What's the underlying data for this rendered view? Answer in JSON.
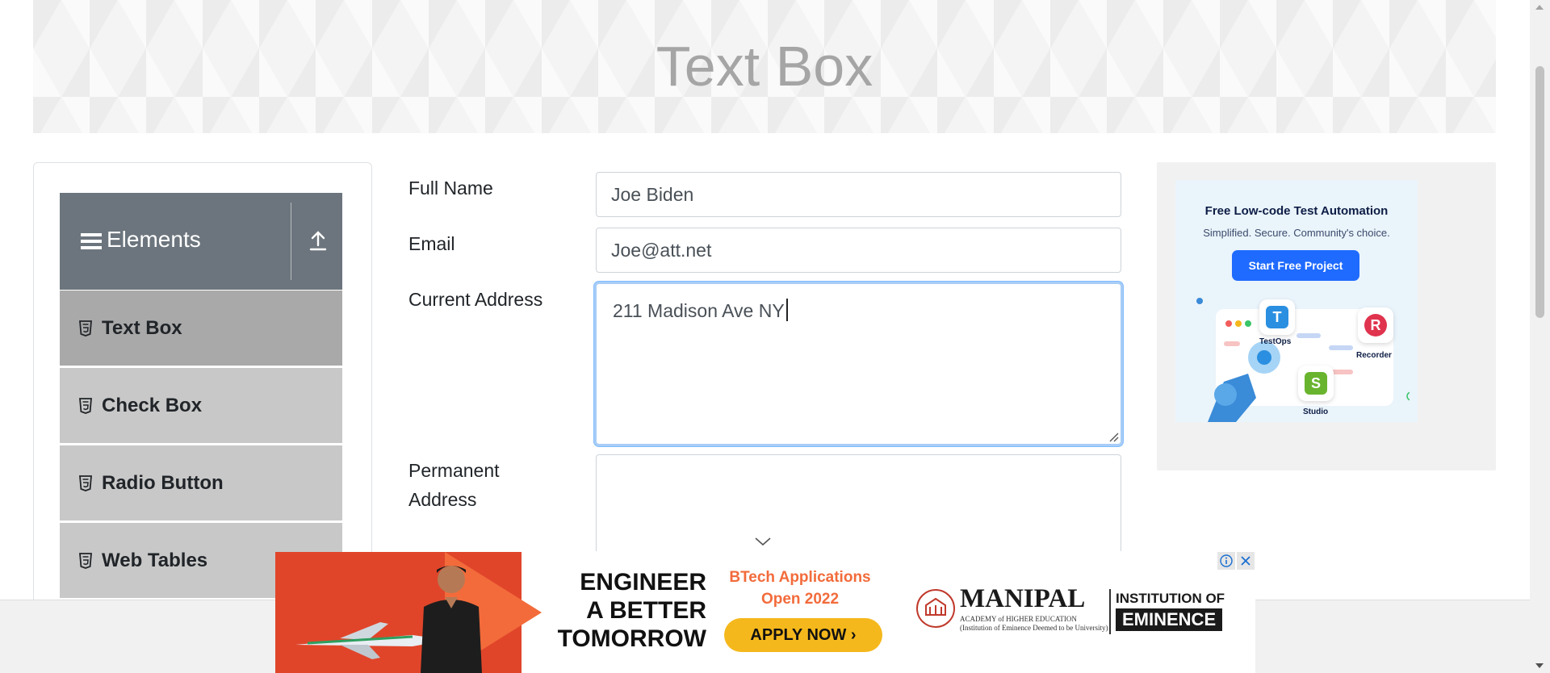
{
  "page": {
    "title": "Text Box"
  },
  "sidebar": {
    "group_title": "Elements",
    "items": [
      {
        "label": "Text Box",
        "active": true
      },
      {
        "label": "Check Box",
        "active": false
      },
      {
        "label": "Radio Button",
        "active": false
      },
      {
        "label": "Web Tables",
        "active": false
      }
    ]
  },
  "form": {
    "full_name": {
      "label": "Full Name",
      "value": "Joe Biden"
    },
    "email": {
      "label": "Email",
      "value": "Joe@att.net"
    },
    "current_address": {
      "label": "Current Address",
      "value": "211 Madison Ave NY"
    },
    "permanent_address": {
      "label_line1": "Permanent",
      "label_line2": "Address",
      "value": ""
    }
  },
  "side_ad": {
    "title": "Free Low-code Test Automation",
    "subtitle": "Simplified. Secure. Community's choice.",
    "button": "Start Free Project",
    "tiles": [
      "TestOps",
      "Recorder",
      "Studio"
    ]
  },
  "bottom_ad": {
    "headline_line1": "ENGINEER",
    "headline_line2": "A BETTER",
    "headline_line3": "TOMORROW",
    "btech_line1": "BTech Applications",
    "btech_line2": "Open 2022",
    "apply": "APPLY NOW ›",
    "brand": "MANIPAL",
    "brand_sub": "ACADEMY of HIGHER EDUCATION",
    "brand_tag": "(Institution of Eminence Deemed to be University)",
    "inst_line1": "INSTITUTION OF",
    "inst_line2": "EMINENCE"
  },
  "colors": {
    "sidebar_header": "#6c757d",
    "menu_item": "#c8c8c8",
    "menu_item_active": "#a9a9a9",
    "focus_border": "#80bdff",
    "ad_button": "#1f6bff",
    "ad_red": "#e0452a",
    "ad_orange": "#f26b3b",
    "ad_yellow": "#f5b81c"
  }
}
